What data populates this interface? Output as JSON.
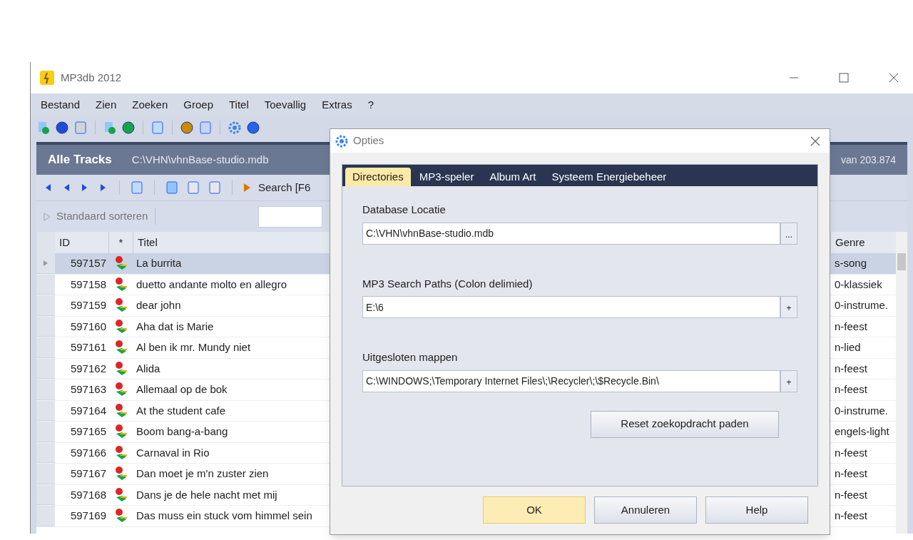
{
  "window": {
    "title": "MP3db 2012"
  },
  "menu": [
    "Bestand",
    "Zien",
    "Zoeken",
    "Groep",
    "Titel",
    "Toevallig",
    "Extras",
    "?"
  ],
  "panel": {
    "title": "Alle Tracks",
    "path": "C:\\VHN\\vhnBase-studio.mdb",
    "count": "van 203.874"
  },
  "nav_toolbar": {
    "search_label": "Search [F6"
  },
  "sort_bar": {
    "sort_label": "Standaard sorteren"
  },
  "table": {
    "columns": [
      "ID",
      "*",
      "Titel",
      "Genre"
    ],
    "rows": [
      {
        "id": "597157",
        "title": "La burrita",
        "genre": "s-song",
        "selected": true
      },
      {
        "id": "597158",
        "title": "duetto andante molto en allegro",
        "genre": "0-klassiek",
        "selected": false
      },
      {
        "id": "597159",
        "title": "dear john",
        "genre": "0-instrume.",
        "selected": false
      },
      {
        "id": "597160",
        "title": "Aha dat is Marie",
        "genre": "n-feest",
        "selected": false
      },
      {
        "id": "597161",
        "title": "Al ben ik mr. Mundy niet",
        "genre": "n-lied",
        "selected": false
      },
      {
        "id": "597162",
        "title": "Alida",
        "genre": "n-feest",
        "selected": false
      },
      {
        "id": "597163",
        "title": "Allemaal op de bok",
        "genre": "n-feest",
        "selected": false
      },
      {
        "id": "597164",
        "title": "At the student cafe",
        "genre": "0-instrume.",
        "selected": false
      },
      {
        "id": "597165",
        "title": "Boom bang-a-bang",
        "genre": "engels-light",
        "selected": false
      },
      {
        "id": "597166",
        "title": "Carnaval in Rio",
        "genre": "n-feest",
        "selected": false
      },
      {
        "id": "597167",
        "title": "Dan moet je m'n zuster zien",
        "genre": "n-feest",
        "selected": false
      },
      {
        "id": "597168",
        "title": "Dans je de hele nacht met mij",
        "genre": "n-feest",
        "selected": false
      },
      {
        "id": "597169",
        "title": "Das muss ein stuck vom himmel sein",
        "genre": "n-feest",
        "selected": false
      }
    ]
  },
  "dialog": {
    "title": "Opties",
    "tabs": [
      {
        "label": "Directories",
        "selected": true
      },
      {
        "label": "MP3-speler",
        "selected": false
      },
      {
        "label": "Album Art",
        "selected": false
      },
      {
        "label": "Systeem Energiebeheer",
        "selected": false
      }
    ],
    "fields": [
      {
        "label": "Database Locatie",
        "value": "C:\\VHN\\vhnBase-studio.mdb",
        "button": "..."
      },
      {
        "label": "MP3 Search Paths (Colon delimied)",
        "value": "E:\\6",
        "button": "+"
      },
      {
        "label": "Uitgesloten mappen",
        "value": "C:\\WINDOWS;\\Temporary Internet Files\\;\\Recycler\\;\\$Recycle.Bin\\",
        "button": "+"
      }
    ],
    "reset_button": "Reset zoekopdracht paden",
    "buttons": [
      {
        "label": "OK",
        "default": true
      },
      {
        "label": "Annuleren",
        "default": false
      },
      {
        "label": "Help",
        "default": false
      }
    ]
  }
}
